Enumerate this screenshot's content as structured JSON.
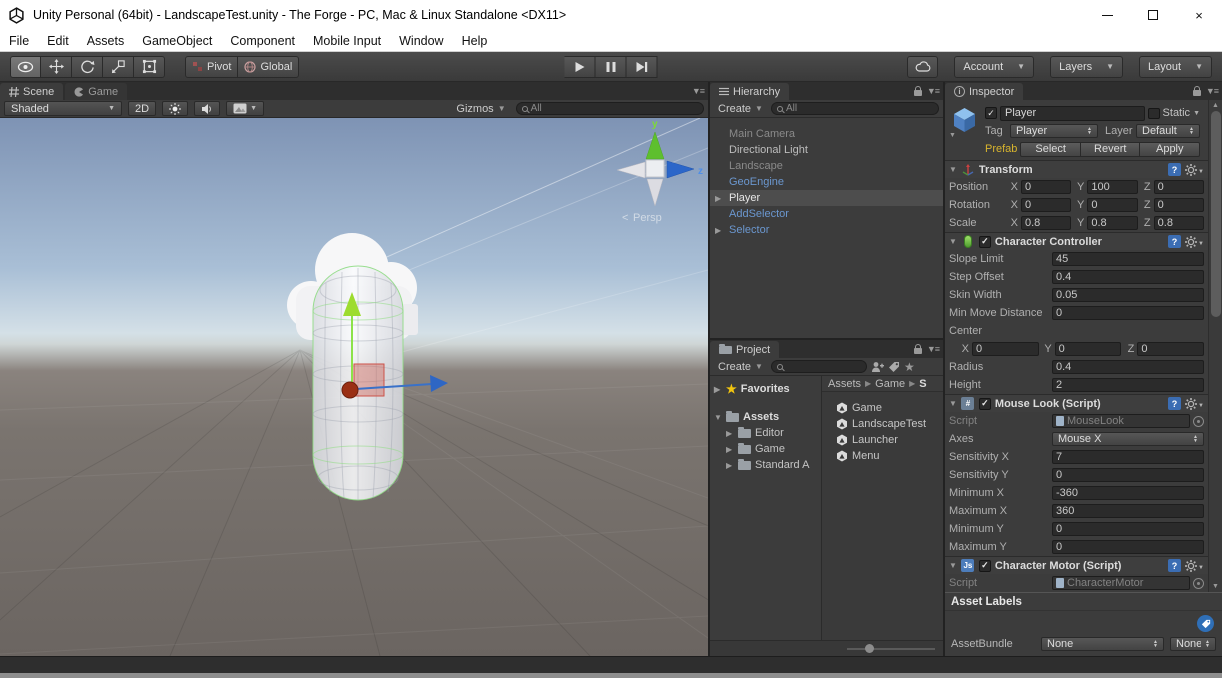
{
  "titlebar": {
    "title": "Unity Personal (64bit) - LandscapeTest.unity - The Forge - PC, Mac & Linux Standalone <DX11>"
  },
  "menubar": {
    "items": [
      "File",
      "Edit",
      "Assets",
      "GameObject",
      "Component",
      "Mobile Input",
      "Window",
      "Help"
    ]
  },
  "toolbar": {
    "pivot": "Pivot",
    "global": "Global",
    "account": "Account",
    "layers": "Layers",
    "layout": "Layout"
  },
  "scene": {
    "tab_scene": "Scene",
    "tab_game": "Game",
    "shaded": "Shaded",
    "mode_2d": "2D",
    "gizmos": "Gizmos",
    "search": "All",
    "axis_y": "y",
    "axis_z": "z",
    "persp": "Persp",
    "persp_arrow": "<"
  },
  "hierarchy": {
    "tab": "Hierarchy",
    "create": "Create",
    "search": "All",
    "items": [
      {
        "label": "Main Camera",
        "state": "dim"
      },
      {
        "label": "Directional Light",
        "state": "normal"
      },
      {
        "label": "Landscape",
        "state": "dim"
      },
      {
        "label": "GeoEngine",
        "state": "prefab"
      },
      {
        "label": "Player",
        "state": "selected"
      },
      {
        "label": "AddSelector",
        "state": "prefab"
      },
      {
        "label": "Selector",
        "state": "prefab"
      }
    ]
  },
  "project": {
    "tab": "Project",
    "create": "Create",
    "favorites": "Favorites",
    "assets_root": "Assets",
    "tree": [
      "Editor",
      "Game",
      "Standard A"
    ],
    "breadcrumb": [
      "Assets",
      "Game",
      "S"
    ],
    "files": [
      "Game",
      "LandscapeTest",
      "Launcher",
      "Menu"
    ]
  },
  "inspector": {
    "tab": "Inspector",
    "header": {
      "name": "Player",
      "static_label": "Static",
      "tag_label": "Tag",
      "tag_value": "Player",
      "layer_label": "Layer",
      "layer_value": "Default",
      "prefab_label": "Prefab",
      "prefab_buttons": [
        "Select",
        "Revert",
        "Apply"
      ]
    },
    "transform": {
      "title": "Transform",
      "position": {
        "label": "Position",
        "x": "0",
        "y": "100",
        "z": "0"
      },
      "rotation": {
        "label": "Rotation",
        "x": "0",
        "y": "0",
        "z": "0"
      },
      "scale": {
        "label": "Scale",
        "x": "0.8",
        "y": "0.8",
        "z": "0.8"
      }
    },
    "character_controller": {
      "title": "Character Controller",
      "slope": {
        "label": "Slope Limit",
        "value": "45"
      },
      "step": {
        "label": "Step Offset",
        "value": "0.4"
      },
      "skin": {
        "label": "Skin Width",
        "value": "0.05"
      },
      "minmove": {
        "label": "Min Move Distance",
        "value": "0"
      },
      "center_label": "Center",
      "center": {
        "x": "0",
        "y": "0",
        "z": "0"
      },
      "radius": {
        "label": "Radius",
        "value": "0.4"
      },
      "height": {
        "label": "Height",
        "value": "2"
      }
    },
    "mouse_look": {
      "title": "Mouse Look (Script)",
      "script": {
        "label": "Script",
        "value": "MouseLook"
      },
      "axes": {
        "label": "Axes",
        "value": "Mouse X"
      },
      "sens_x": {
        "label": "Sensitivity X",
        "value": "7"
      },
      "sens_y": {
        "label": "Sensitivity Y",
        "value": "0"
      },
      "min_x": {
        "label": "Minimum X",
        "value": "-360"
      },
      "max_x": {
        "label": "Maximum X",
        "value": "360"
      },
      "min_y": {
        "label": "Minimum Y",
        "value": "0"
      },
      "max_y": {
        "label": "Maximum Y",
        "value": "0"
      }
    },
    "character_motor": {
      "title": "Character Motor (Script)",
      "script": {
        "label": "Script",
        "value": "CharacterMotor"
      }
    },
    "asset_labels": {
      "title": "Asset Labels",
      "assetbundle_label": "AssetBundle",
      "bundle": "None",
      "variant": "None"
    }
  },
  "colors": {
    "prefab_text": "#6b97cf",
    "prefab_yellow": "#d8b52e",
    "selection_row": "#4d4d4d",
    "panel_bg": "#3c3c3c",
    "axis_green": "#8ce24a",
    "axis_blue": "#2e66c4",
    "axis_red": "#9a2f14"
  }
}
